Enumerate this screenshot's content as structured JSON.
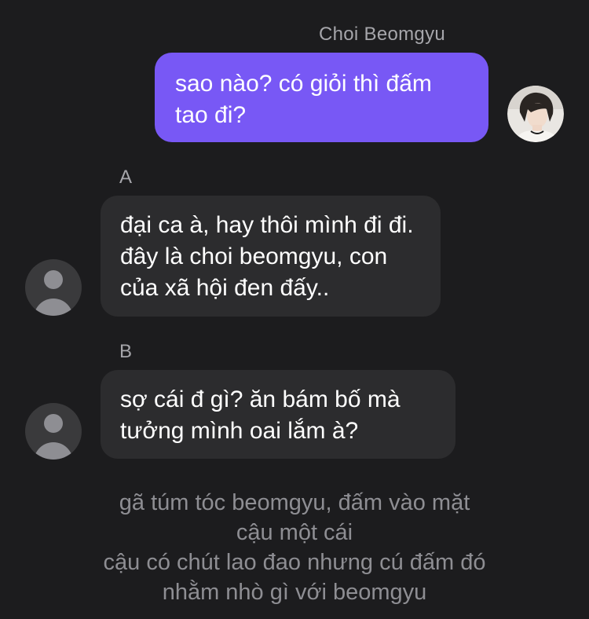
{
  "messages": [
    {
      "sender": "Choi Beomgyu",
      "direction": "outgoing",
      "text": "sao nào? có giỏi thì đấm tao đi?"
    },
    {
      "sender": "A",
      "direction": "incoming",
      "text": "đại ca à, hay thôi mình đi đi. đây là choi beomgyu, con của xã hội đen đấy.."
    },
    {
      "sender": "B",
      "direction": "incoming",
      "text": "sợ cái đ gì? ăn bám bố mà tưởng mình oai lắm à?"
    }
  ],
  "narration": [
    "gã túm tóc beomgyu, đấm vào mặt",
    "cậu một cái",
    "cậu có chút lao đao nhưng cú đấm đó",
    "nhằm nhò gì với beomgyu"
  ],
  "colors": {
    "background": "#1c1c1e",
    "outgoing_bubble": "#7858f5",
    "incoming_bubble": "#2c2c2e",
    "sender_name": "#a6a6ab",
    "narration_text": "#8e8e93"
  },
  "icons": {
    "default_avatar": "person-placeholder-icon",
    "user_avatar": "profile-photo"
  }
}
